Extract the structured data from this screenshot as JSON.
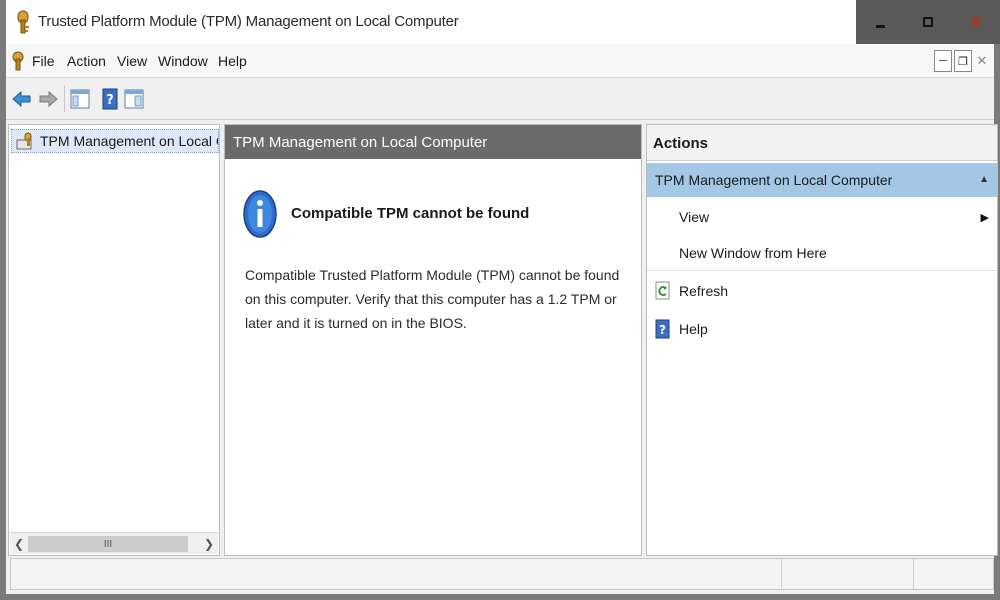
{
  "window": {
    "title": "Trusted Platform Module (TPM) Management on Local Computer",
    "close_label": "X"
  },
  "menubar": {
    "items": [
      "File",
      "Action",
      "View",
      "Window",
      "Help"
    ]
  },
  "toolbar": {
    "icons": [
      "back-arrow-icon",
      "forward-arrow-icon",
      "show-hide-console-tree-icon",
      "help-icon",
      "show-hide-action-pane-icon"
    ]
  },
  "tree": {
    "selected": "TPM Management on Local Computer"
  },
  "center": {
    "header": "TPM Management on Local Computer",
    "info_title": "Compatible TPM cannot be found",
    "info_text": "Compatible Trusted Platform Module (TPM) cannot be found on this computer. Verify that this computer has a 1.2 TPM or later and it is turned on in the BIOS."
  },
  "actions": {
    "header": "Actions",
    "group": "TPM Management on Local Computer",
    "items": [
      {
        "label": "View",
        "icon": "",
        "submenu": true
      },
      {
        "label": "New Window from Here",
        "icon": "",
        "submenu": false
      },
      {
        "label": "Refresh",
        "icon": "refresh-icon",
        "submenu": false
      },
      {
        "label": "Help",
        "icon": "help-icon",
        "submenu": false
      }
    ]
  },
  "scrollbar": {
    "thumb_glyph": "III"
  },
  "colors": {
    "selection": "#a4c7e6",
    "header_dark": "#6b6b6b",
    "chrome": "#5a5a5a"
  }
}
